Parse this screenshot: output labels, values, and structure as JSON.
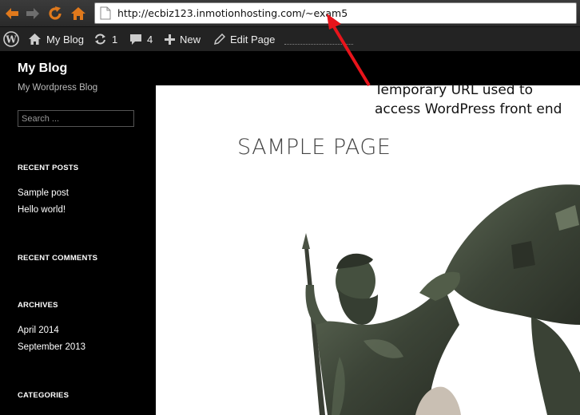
{
  "browser": {
    "url": "http://ecbiz123.inmotionhosting.com/~exam5",
    "icons": [
      "back-arrow-icon",
      "forward-arrow-icon",
      "reload-icon",
      "home-icon",
      "page-icon"
    ]
  },
  "admin_bar": {
    "site_name": "My Blog",
    "updates_count": "1",
    "comments_count": "4",
    "new_label": "New",
    "edit_label": "Edit Page"
  },
  "sidebar": {
    "site_title": "My Blog",
    "site_description": "My Wordpress Blog",
    "search_placeholder": "Search ...",
    "recent_posts_title": "RECENT POSTS",
    "recent_posts": [
      "Sample post",
      "Hello world!"
    ],
    "recent_comments_title": "RECENT COMMENTS",
    "archives_title": "ARCHIVES",
    "archives": [
      "April 2014",
      "September 2013"
    ],
    "categories_title": "CATEGORIES"
  },
  "content": {
    "page_title": "SAMPLE PAGE"
  },
  "annotation": {
    "text": "Temporary URL used to access WordPress front end",
    "color": "#e8141b"
  }
}
